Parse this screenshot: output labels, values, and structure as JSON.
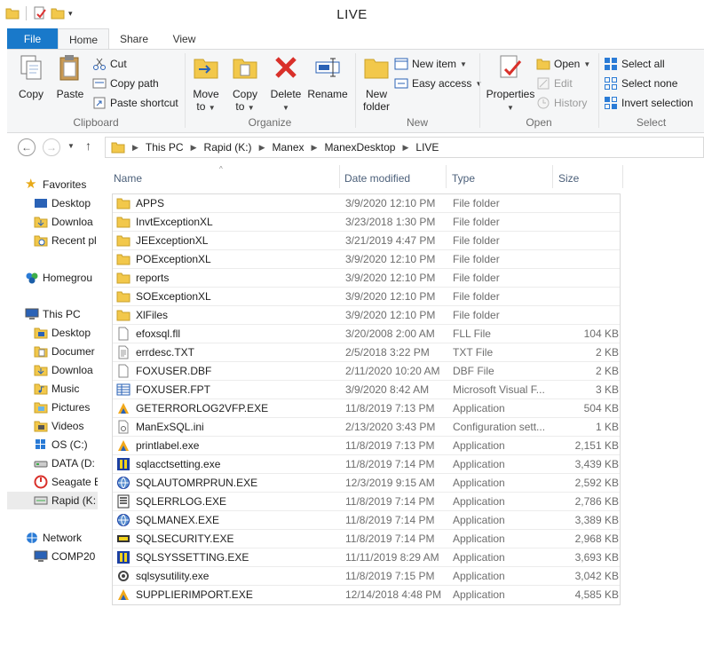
{
  "window": {
    "title": "LIVE"
  },
  "quick_access": [
    "folder-icon",
    "properties-icon",
    "new-folder-icon",
    "customize-dropdown"
  ],
  "ribbon_tabs": [
    "File",
    "Home",
    "Share",
    "View"
  ],
  "ribbon": {
    "clipboard": {
      "label": "Clipboard",
      "copy": "Copy",
      "paste": "Paste",
      "cut": "Cut",
      "copy_path": "Copy path",
      "paste_shortcut": "Paste shortcut"
    },
    "organize": {
      "label": "Organize",
      "move_to": "Move",
      "move_to_2": "to",
      "copy_to": "Copy",
      "copy_to_2": "to",
      "delete": "Delete",
      "rename": "Rename"
    },
    "new": {
      "label": "New",
      "new_folder": "New",
      "new_folder_2": "folder",
      "new_item": "New item",
      "easy_access": "Easy access"
    },
    "open": {
      "label": "Open",
      "properties": "Properties",
      "open": "Open",
      "edit": "Edit",
      "history": "History"
    },
    "select": {
      "label": "Select",
      "select_all": "Select all",
      "select_none": "Select none",
      "invert": "Invert selection"
    }
  },
  "address": {
    "crumbs": [
      "This PC",
      "Rapid (K:)",
      "Manex",
      "ManexDesktop",
      "LIVE"
    ]
  },
  "nav": {
    "favorites": "Favorites",
    "desktop": "Desktop",
    "downloads": "Downloa",
    "recent": "Recent pl",
    "homegroup": "Homegrou",
    "this_pc": "This PC",
    "pc_desktop": "Desktop",
    "documents": "Documer",
    "pc_downloads": "Downloa",
    "music": "Music",
    "pictures": "Pictures",
    "videos": "Videos",
    "os_c": "OS (C:)",
    "data_d": "DATA (D:",
    "seagate": "Seagate E",
    "rapid_k": "Rapid (K:",
    "network": "Network",
    "comp": "COMP20"
  },
  "columns": {
    "name": "Name",
    "date": "Date modified",
    "type": "Type",
    "size": "Size"
  },
  "files": [
    {
      "name": "APPS",
      "date": "3/9/2020 12:10 PM",
      "type": "File folder",
      "size": "",
      "icon": "folder-icon"
    },
    {
      "name": "InvtExceptionXL",
      "date": "3/23/2018 1:30 PM",
      "type": "File folder",
      "size": "",
      "icon": "folder-icon"
    },
    {
      "name": "JEExceptionXL",
      "date": "3/21/2019 4:47 PM",
      "type": "File folder",
      "size": "",
      "icon": "folder-icon"
    },
    {
      "name": "POExceptionXL",
      "date": "3/9/2020 12:10 PM",
      "type": "File folder",
      "size": "",
      "icon": "folder-icon"
    },
    {
      "name": "reports",
      "date": "3/9/2020 12:10 PM",
      "type": "File folder",
      "size": "",
      "icon": "folder-icon"
    },
    {
      "name": "SOExceptionXL",
      "date": "3/9/2020 12:10 PM",
      "type": "File folder",
      "size": "",
      "icon": "folder-icon"
    },
    {
      "name": "XlFiles",
      "date": "3/9/2020 12:10 PM",
      "type": "File folder",
      "size": "",
      "icon": "folder-icon"
    },
    {
      "name": "efoxsql.fll",
      "date": "3/20/2008 2:00 AM",
      "type": "FLL File",
      "size": "104 KB",
      "icon": "file-icon"
    },
    {
      "name": "errdesc.TXT",
      "date": "2/5/2018 3:22 PM",
      "type": "TXT File",
      "size": "2 KB",
      "icon": "text-file-icon"
    },
    {
      "name": "FOXUSER.DBF",
      "date": "2/11/2020 10:20 AM",
      "type": "DBF File",
      "size": "2 KB",
      "icon": "file-icon"
    },
    {
      "name": "FOXUSER.FPT",
      "date": "3/9/2020 8:42 AM",
      "type": "Microsoft Visual F...",
      "size": "3 KB",
      "icon": "table-file-icon"
    },
    {
      "name": "GETERRORLOG2VFP.EXE",
      "date": "11/8/2019 7:13 PM",
      "type": "Application",
      "size": "504 KB",
      "icon": "vfp-app-icon"
    },
    {
      "name": "ManExSQL.ini",
      "date": "2/13/2020 3:43 PM",
      "type": "Configuration sett...",
      "size": "1 KB",
      "icon": "config-file-icon"
    },
    {
      "name": "printlabel.exe",
      "date": "11/8/2019 7:13 PM",
      "type": "Application",
      "size": "2,151 KB",
      "icon": "vfp-app-icon"
    },
    {
      "name": "sqlacctsetting.exe",
      "date": "11/8/2019 7:14 PM",
      "type": "Application",
      "size": "3,439 KB",
      "icon": "app-icon"
    },
    {
      "name": "SQLAUTOMRPRUN.EXE",
      "date": "12/3/2019 9:15 AM",
      "type": "Application",
      "size": "2,592 KB",
      "icon": "globe-app-icon"
    },
    {
      "name": "SQLERRLOG.EXE",
      "date": "11/8/2019 7:14 PM",
      "type": "Application",
      "size": "2,786 KB",
      "icon": "log-app-icon"
    },
    {
      "name": "SQLMANEX.EXE",
      "date": "11/8/2019 7:14 PM",
      "type": "Application",
      "size": "3,389 KB",
      "icon": "globe-app-icon"
    },
    {
      "name": "SQLSECURITY.EXE",
      "date": "11/8/2019 7:14 PM",
      "type": "Application",
      "size": "2,968 KB",
      "icon": "security-app-icon"
    },
    {
      "name": "SQLSYSSETTING.EXE",
      "date": "11/11/2019 8:29 AM",
      "type": "Application",
      "size": "3,693 KB",
      "icon": "app-icon"
    },
    {
      "name": "sqlsysutility.exe",
      "date": "11/8/2019 7:15 PM",
      "type": "Application",
      "size": "3,042 KB",
      "icon": "gear-app-icon"
    },
    {
      "name": "SUPPLIERIMPORT.EXE",
      "date": "12/14/2018 4:48 PM",
      "type": "Application",
      "size": "4,585 KB",
      "icon": "vfp-app-icon"
    }
  ]
}
